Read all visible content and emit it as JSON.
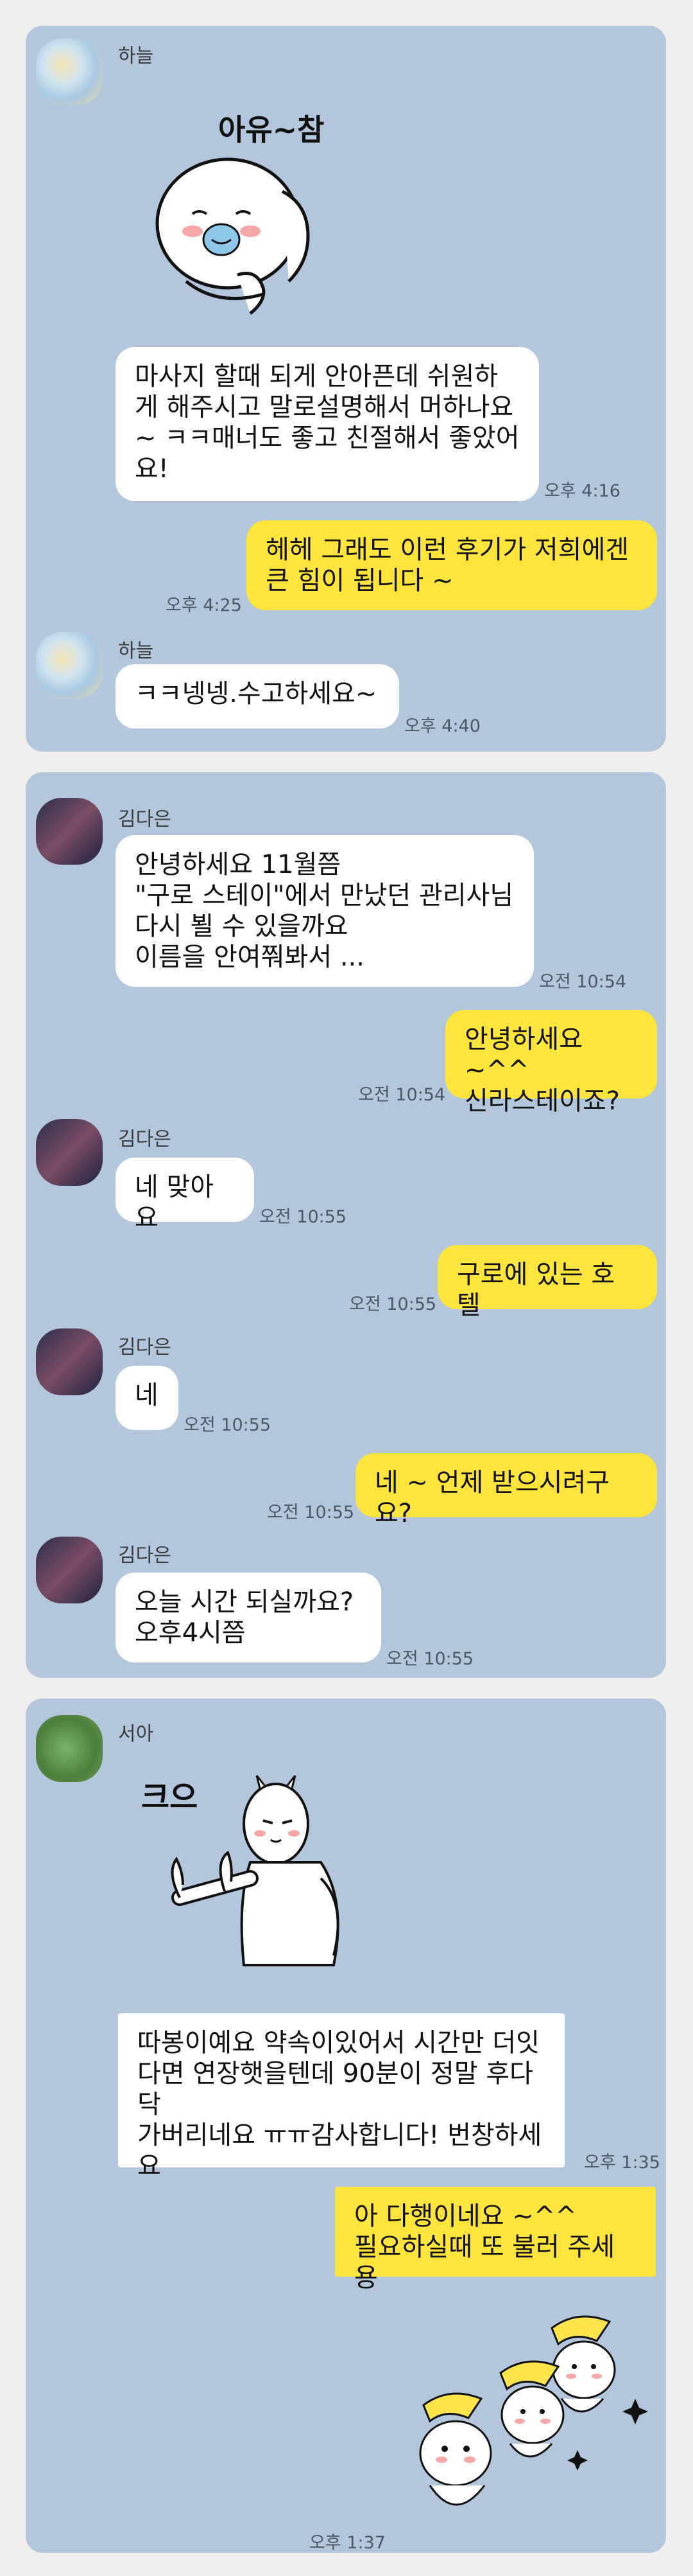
{
  "panels": [
    {
      "messages": [
        {
          "sender": "하늘",
          "type": "sticker",
          "sticker_text": "아유~참"
        },
        {
          "sender": "하늘",
          "type": "text",
          "text": "마사지 할때 되게 안아픈데 쉬원하\n게 해주시고 말로설명해서 머하나요\n~ ㅋㅋ매너도 좋고 친절해서 좋았어\n요!",
          "time": "오후 4:16"
        },
        {
          "sender": "me",
          "type": "text",
          "text": "헤헤 그래도 이런 후기가 저희에겐\n큰 힘이 됩니다 ~",
          "time": "오후 4:25"
        },
        {
          "sender": "하늘",
          "type": "text",
          "text": "ㅋㅋ넹넹.수고하세요~",
          "time": "오후 4:40"
        }
      ]
    },
    {
      "messages": [
        {
          "sender": "김다은",
          "type": "text",
          "text": "안녕하세요 11월쯤\n\"구로 스테이\"에서 만났던 관리사님\n다시 뵐 수 있을까요\n이름을 안여쭤봐서 ...",
          "time": "오전 10:54"
        },
        {
          "sender": "me",
          "type": "text",
          "text": "안녕하세요 ~^^\n신라스테이죠?",
          "time": "오전 10:54"
        },
        {
          "sender": "김다은",
          "type": "text",
          "text": "네 맞아요",
          "time": "오전 10:55"
        },
        {
          "sender": "me",
          "type": "text",
          "text": "구로에 있는 호텔",
          "time": "오전 10:55"
        },
        {
          "sender": "김다은",
          "type": "text",
          "text": "네",
          "time": "오전 10:55"
        },
        {
          "sender": "me",
          "type": "text",
          "text": "네 ~ 언제 받으시려구요?",
          "time": "오전 10:55"
        },
        {
          "sender": "김다은",
          "type": "text",
          "text": "오늘  시간 되실까요?\n오후4시쯤",
          "time": "오전 10:55"
        }
      ]
    },
    {
      "messages": [
        {
          "sender": "서아",
          "type": "sticker",
          "sticker_text": "크으"
        },
        {
          "sender": "서아",
          "type": "text",
          "text": "따봉이예요 약속이있어서 시간만 더잇\n다면 연장햇을텐데 90분이 정말 후다닥\n가버리네요 ㅠㅠ감사합니다! 번창하세\n요",
          "time": "오후 1:35"
        },
        {
          "sender": "me",
          "type": "text",
          "text": "아 다행이네요 ~^^\n필요하실때 또 불러 주세용",
          "time": ""
        },
        {
          "sender": "me",
          "type": "sticker",
          "sticker_text": "",
          "time": "오후 1:37"
        }
      ]
    }
  ],
  "colors": {
    "background": "#f1efee",
    "panel": "#b4c6dc",
    "my_bubble": "#fee43c",
    "their_bubble": "#ffffff"
  }
}
